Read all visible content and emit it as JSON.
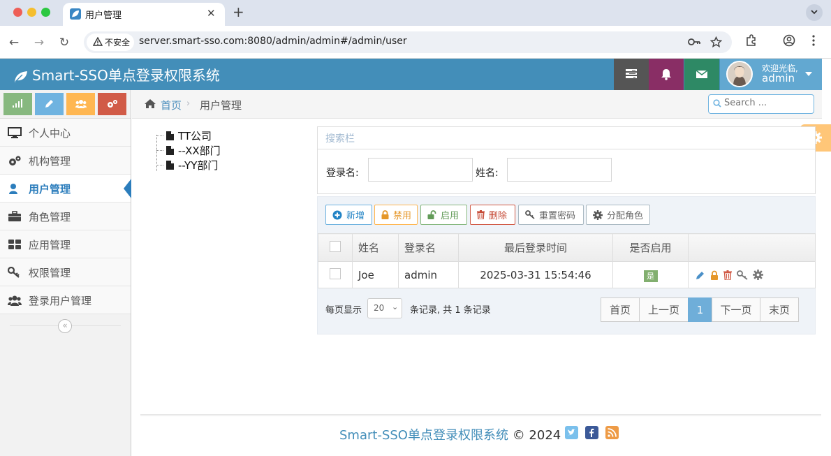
{
  "browser": {
    "tab_title": "用户管理",
    "insecure_label": "不安全",
    "url": "server.smart-sso.com:8080/admin/admin#/admin/user"
  },
  "header": {
    "brand": "Smart-SSO单点登录权限系统",
    "greeting": "欢迎光临,",
    "username": "admin"
  },
  "sidebar": {
    "items": [
      {
        "label": "个人中心",
        "icon": "desktop-icon",
        "active": false
      },
      {
        "label": "机构管理",
        "icon": "cogs-icon",
        "active": false
      },
      {
        "label": "用户管理",
        "icon": "user-icon",
        "active": true
      },
      {
        "label": "角色管理",
        "icon": "briefcase-icon",
        "active": false
      },
      {
        "label": "应用管理",
        "icon": "grid-icon",
        "active": false
      },
      {
        "label": "权限管理",
        "icon": "key-icon",
        "active": false
      },
      {
        "label": "登录用户管理",
        "icon": "users-icon",
        "active": false
      }
    ]
  },
  "breadcrumb": {
    "home": "首页",
    "current": "用户管理",
    "search_placeholder": "Search ..."
  },
  "tree": {
    "nodes": [
      "TT公司",
      "--XX部门",
      "--YY部门"
    ]
  },
  "search_panel": {
    "title": "搜索栏",
    "login_label": "登录名:",
    "name_label": "姓名:"
  },
  "toolbar": {
    "add": "新增",
    "disable": "禁用",
    "enable": "启用",
    "delete": "删除",
    "reset_password": "重置密码",
    "assign_role": "分配角色"
  },
  "table": {
    "columns": [
      "姓名",
      "登录名",
      "最后登录时间",
      "是否启用"
    ],
    "rows": [
      {
        "name": "Joe",
        "login": "admin",
        "last_login": "2025-03-31 15:54:46",
        "enabled": "是"
      }
    ]
  },
  "pager": {
    "per_page_label": "每页显示",
    "page_size": "20",
    "records_label": "条记录, 共 1 条记录",
    "first": "首页",
    "prev": "上一页",
    "current": "1",
    "next": "下一页",
    "last": "末页"
  },
  "footer": {
    "brand": "Smart-SSO单点登录权限系统",
    "copyright": "© 2024"
  },
  "colors": {
    "header_blue": "#438eb9",
    "active_blue": "#2b7dbc",
    "tasks": "#555555",
    "bell": "#892e65",
    "mail": "#2e8965",
    "yes_badge": "#82af6f"
  }
}
